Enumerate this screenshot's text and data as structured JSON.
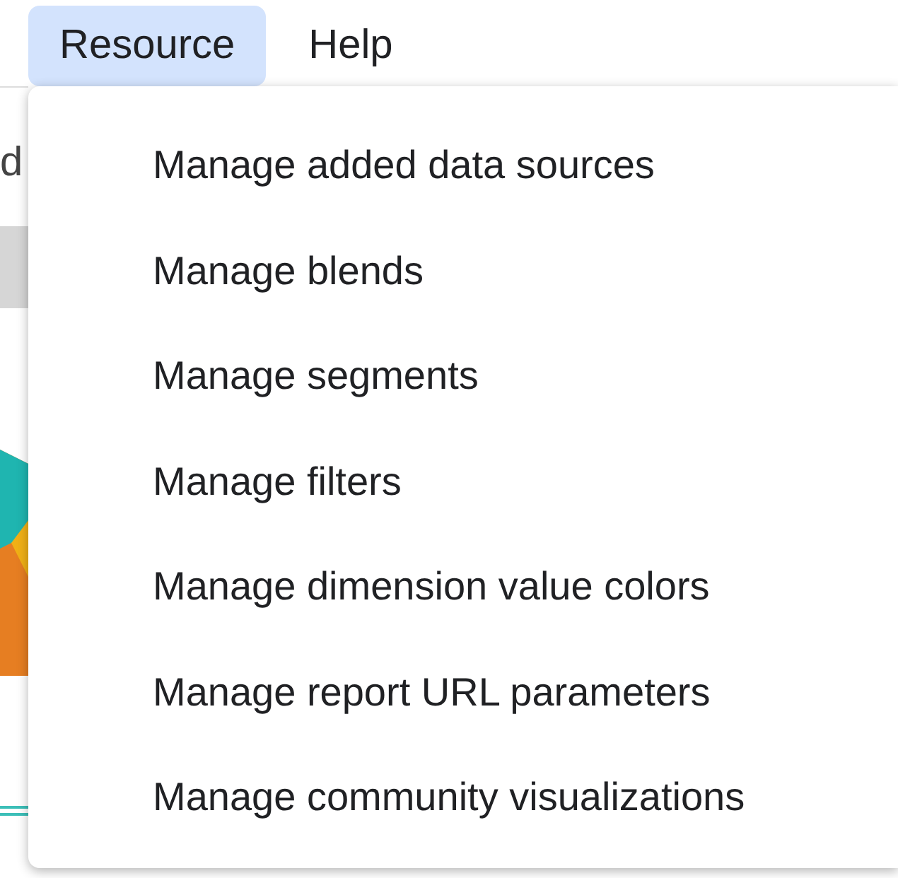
{
  "menu_bar": [
    {
      "label": "Resource",
      "selected": true
    },
    {
      "label": "Help",
      "selected": false
    }
  ],
  "background": {
    "text": "d"
  },
  "menu": {
    "items": [
      {
        "label": "Manage added data sources"
      },
      {
        "label": "Manage blends"
      },
      {
        "label": "Manage segments"
      },
      {
        "label": "Manage filters"
      },
      {
        "label": "Manage dimension value colors"
      },
      {
        "label": "Manage report URL parameters"
      },
      {
        "label": "Manage community visualizations"
      }
    ]
  }
}
